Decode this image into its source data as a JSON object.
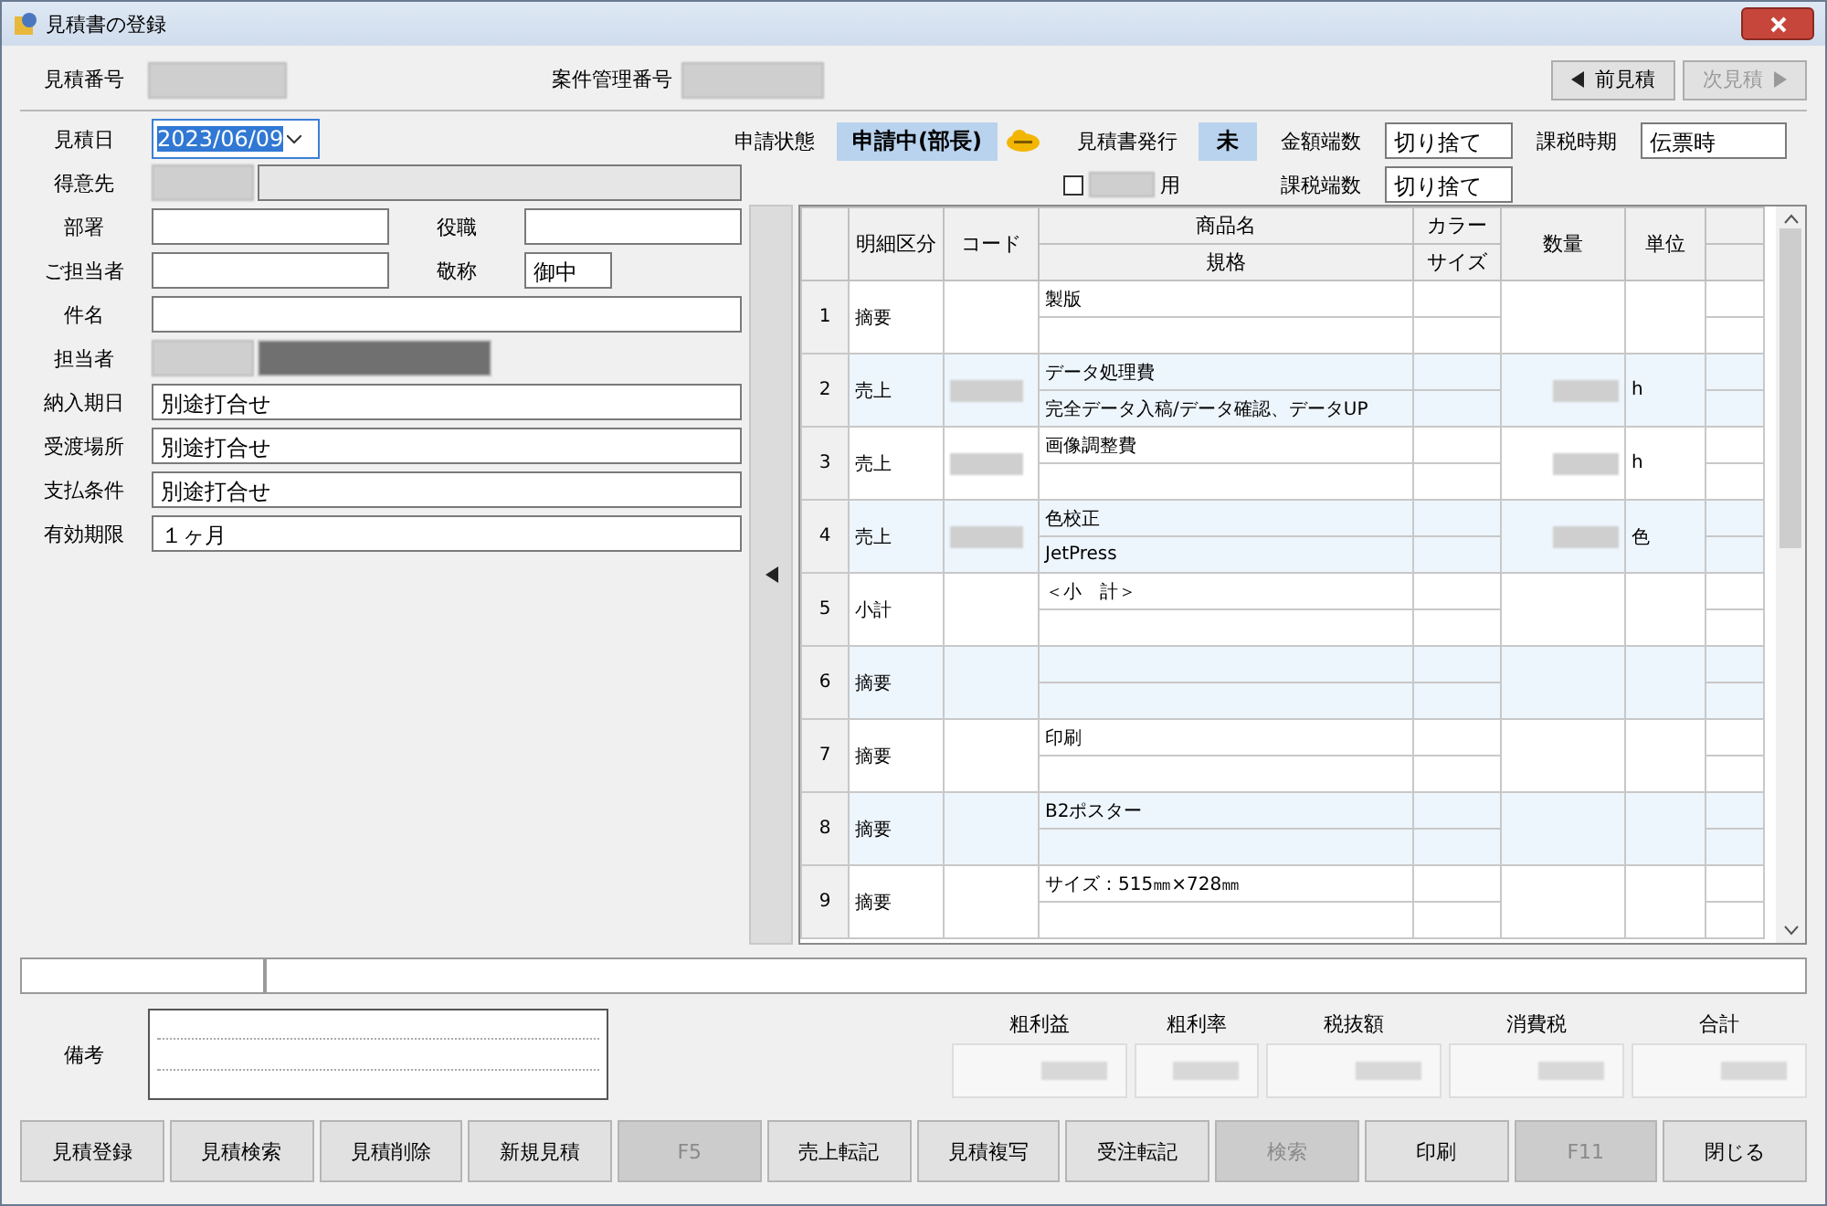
{
  "window": {
    "title": "見積書の登録"
  },
  "header": {
    "estimate_no_label": "見積番号",
    "project_no_label": "案件管理番号",
    "nav_buttons": [
      {
        "kind": "prev",
        "label": "前見積",
        "disabled": false
      },
      {
        "kind": "next",
        "label": "次見積",
        "disabled": true
      }
    ]
  },
  "form": {
    "date": {
      "label": "見積日",
      "value": "2023/06/09"
    },
    "customer": {
      "label": "得意先"
    },
    "dept": {
      "label": "部署"
    },
    "position": {
      "label": "役職"
    },
    "contact": {
      "label": "ご担当者"
    },
    "honorific": {
      "label": "敬称",
      "value": "御中"
    },
    "subject": {
      "label": "件名"
    },
    "staff": {
      "label": "担当者"
    },
    "terms": [
      {
        "label": "納入期日",
        "value": "別途打合せ"
      },
      {
        "label": "受渡場所",
        "value": "別途打合せ"
      },
      {
        "label": "支払条件",
        "value": "別途打合せ"
      },
      {
        "label": "有効期限",
        "value": "１ヶ月"
      }
    ]
  },
  "info": {
    "status_label": "申請状態",
    "status_value": "申請中(部長)",
    "issued_label": "見積書発行",
    "issued_value": "未",
    "amount_rounding": {
      "label": "金額端数",
      "value": "切り捨て"
    },
    "tax_timing": {
      "label": "課税時期",
      "value": "伝票時"
    },
    "tax_rounding": {
      "label": "課税端数",
      "value": "切り捨て"
    },
    "option": {
      "label": "用",
      "checked": false
    }
  },
  "grid": {
    "headers": {
      "type": "明細区分",
      "code": "コード",
      "name": "商品名",
      "spec": "規格",
      "variant": "カラー",
      "size": "サイズ",
      "qty": "数量",
      "unit": "単位"
    },
    "rows": [
      {
        "no": "1",
        "type": "摘要",
        "name": "製版",
        "spec": "",
        "unit": "",
        "redacted": false
      },
      {
        "no": "2",
        "type": "売上",
        "name": "データ処理費",
        "spec": "完全データ入稿/データ確認、データUP",
        "unit": "h",
        "redacted": true
      },
      {
        "no": "3",
        "type": "売上",
        "name": "画像調整費",
        "spec": "",
        "unit": "h",
        "redacted": true
      },
      {
        "no": "4",
        "type": "売上",
        "name": "色校正",
        "spec": "JetPress",
        "unit": "色",
        "redacted": true
      },
      {
        "no": "5",
        "type": "小計",
        "name": "＜小　計＞",
        "spec": "",
        "unit": "",
        "redacted": false
      },
      {
        "no": "6",
        "type": "摘要",
        "name": "",
        "spec": "",
        "unit": "",
        "redacted": false
      },
      {
        "no": "7",
        "type": "摘要",
        "name": "印刷",
        "spec": "",
        "unit": "",
        "redacted": false
      },
      {
        "no": "8",
        "type": "摘要",
        "name": "B2ポスター",
        "spec": "",
        "unit": "",
        "redacted": false
      },
      {
        "no": "9",
        "type": "摘要",
        "name": "サイズ：515㎜×728㎜",
        "spec": "",
        "unit": "",
        "redacted": false
      }
    ]
  },
  "remarks": {
    "label": "備考"
  },
  "totals": [
    {
      "label": "粗利益"
    },
    {
      "label": "粗利率"
    },
    {
      "label": "税抜額"
    },
    {
      "label": "消費税"
    },
    {
      "label": "合計"
    }
  ],
  "buttons": [
    {
      "label": "見積登録",
      "disabled": false
    },
    {
      "label": "見積検索",
      "disabled": false
    },
    {
      "label": "見積削除",
      "disabled": false
    },
    {
      "label": "新規見積",
      "disabled": false
    },
    {
      "label": "F5",
      "disabled": true
    },
    {
      "label": "売上転記",
      "disabled": false
    },
    {
      "label": "見積複写",
      "disabled": false
    },
    {
      "label": "受注転記",
      "disabled": false
    },
    {
      "label": "検索",
      "disabled": true
    },
    {
      "label": "印刷",
      "disabled": false
    },
    {
      "label": "F11",
      "disabled": true
    },
    {
      "label": "閉じる",
      "disabled": false
    }
  ]
}
